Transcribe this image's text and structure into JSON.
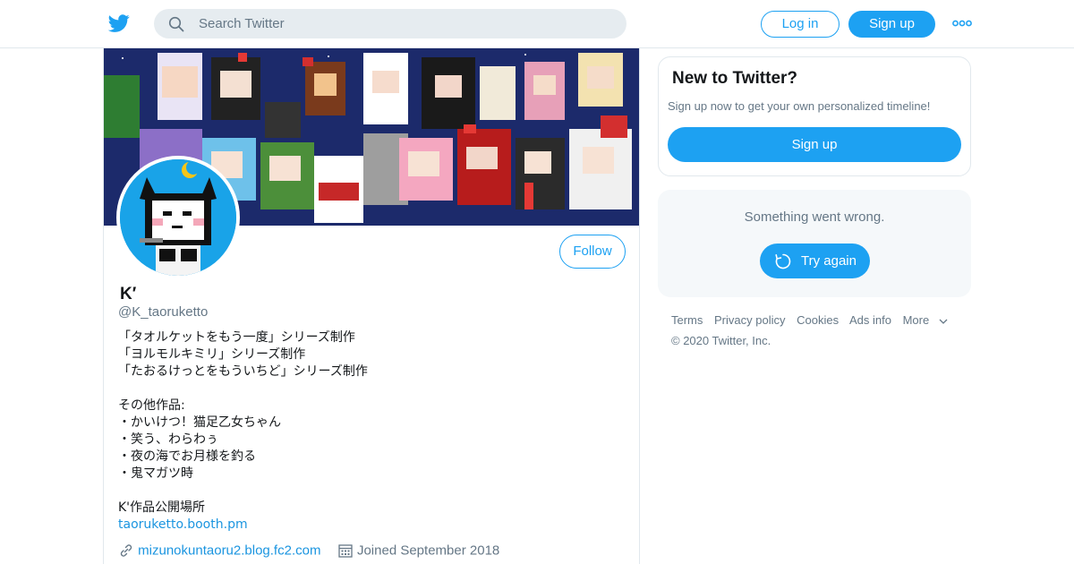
{
  "header": {
    "search_placeholder": "Search Twitter",
    "login_label": "Log in",
    "signup_label": "Sign up"
  },
  "profile": {
    "display_name": "K′",
    "handle": "@K_taoruketto",
    "follow_label": "Follow",
    "bio_lines": [
      "「タオルケットをもう一度」シリーズ制作",
      "「ヨルモルキミリ」シリーズ制作",
      "「たおるけっとをもういちど」シリーズ制作",
      "",
      "その他作品:",
      "・かいけつ！猫足乙女ちゃん",
      "・笑う、わらわぅ",
      "・夜の海でお月様を釣る",
      "・鬼マガツ時",
      "",
      "K'作品公開場所"
    ],
    "bio_link": "taoruketto.booth.pm",
    "website": "mizunokuntaoru2.blog.fc2.com",
    "joined": "Joined September 2018"
  },
  "signup_card": {
    "title": "New to Twitter?",
    "subtitle": "Sign up now to get your own personalized timeline!",
    "button_label": "Sign up"
  },
  "error_card": {
    "message": "Something went wrong.",
    "retry_label": "Try again"
  },
  "footer": {
    "links": [
      "Terms",
      "Privacy policy",
      "Cookies",
      "Ads info",
      "More"
    ],
    "copyright": "© 2020 Twitter, Inc."
  },
  "colors": {
    "brand_blue": "#1da1f2",
    "link_blue": "#1b95e0",
    "secondary_text": "#657786",
    "banner_bg": "#1c2a6b",
    "avatar_bg": "#19a3e8"
  },
  "icons": [
    "twitter-logo-icon",
    "search-icon",
    "more-dots-icon",
    "link-icon",
    "calendar-icon",
    "retry-icon",
    "chevron-down-icon"
  ]
}
